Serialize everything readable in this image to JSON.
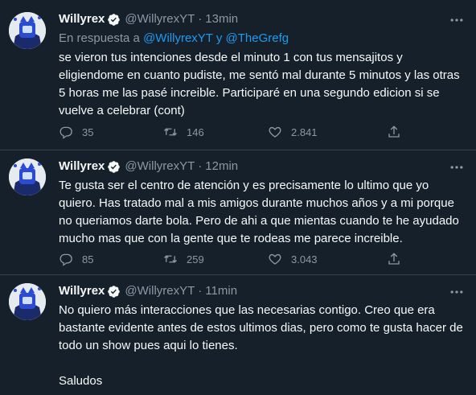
{
  "tweets": [
    {
      "name": "Willyrex",
      "handle": "@WillyrexYT",
      "time": "13min",
      "reply_prefix": "En respuesta a",
      "reply_user1": "@WillyrexYT",
      "reply_and": "y",
      "reply_user2": "@TheGrefg",
      "text": "se vieron tus intenciones desde el minuto 1 con tus mensajitos y eligiendome en cuanto pudiste, me sentó mal durante 5 minutos y las otras 5 horas me las pasé increible. Participaré en una segundo edicion si se vuelve a celebrar (cont)",
      "replies": "35",
      "retweets": "146",
      "likes": "2.841"
    },
    {
      "name": "Willyrex",
      "handle": "@WillyrexYT",
      "time": "12min",
      "text": "Te gusta ser el centro de atención y es precisamente lo ultimo que yo quiero. Has tratado mal a mis amigos durante muchos años y a mi porque no queriamos darte bola. Pero de ahi a que mientas cuando te he ayudado mucho mas que con la gente que te rodeas me parece increible.",
      "replies": "85",
      "retweets": "259",
      "likes": "3.043"
    },
    {
      "name": "Willyrex",
      "handle": "@WillyrexYT",
      "time": "11min",
      "text": "No quiero más interacciones que las necesarias contigo. Creo que era bastante evidente antes de estos ultimos dias, pero como te gusta hacer de todo un show pues aqui lo tienes.\n\nSaludos"
    }
  ],
  "icons": {
    "verified": "verified-badge-icon",
    "more": "more-dots-icon",
    "reply": "reply-icon",
    "retweet": "retweet-icon",
    "like": "heart-icon",
    "share": "share-icon"
  },
  "colors": {
    "background": "#15202b",
    "text": "#f7f9f9",
    "muted": "#8b98a5",
    "accent": "#1d9bf0",
    "separator": "#38444d"
  }
}
